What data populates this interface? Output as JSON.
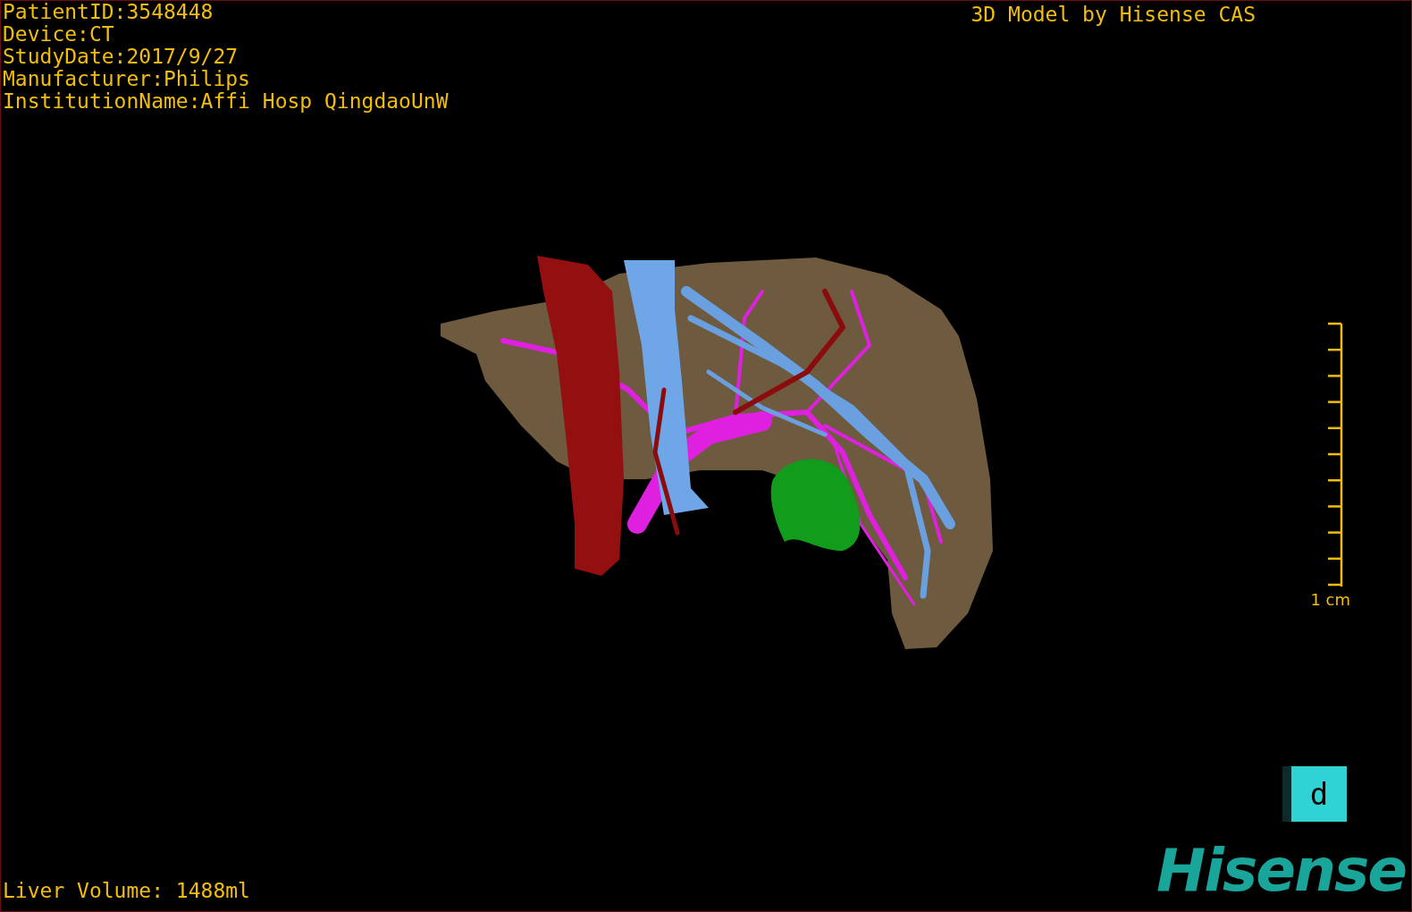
{
  "info_lines": [
    "PatientID:3548448",
    "Device:CT",
    "StudyDate:2017/9/27",
    "Manufacturer:Philips",
    "InstitutionName:Affi Hosp QingdaoUnW"
  ],
  "title": "3D Model by Hisense CAS",
  "scale_bar": {
    "label": "1 cm"
  },
  "view_button": {
    "label": "d"
  },
  "logo": {
    "text": "Hisense"
  },
  "measurement": "Liver Volume: 1488ml"
}
